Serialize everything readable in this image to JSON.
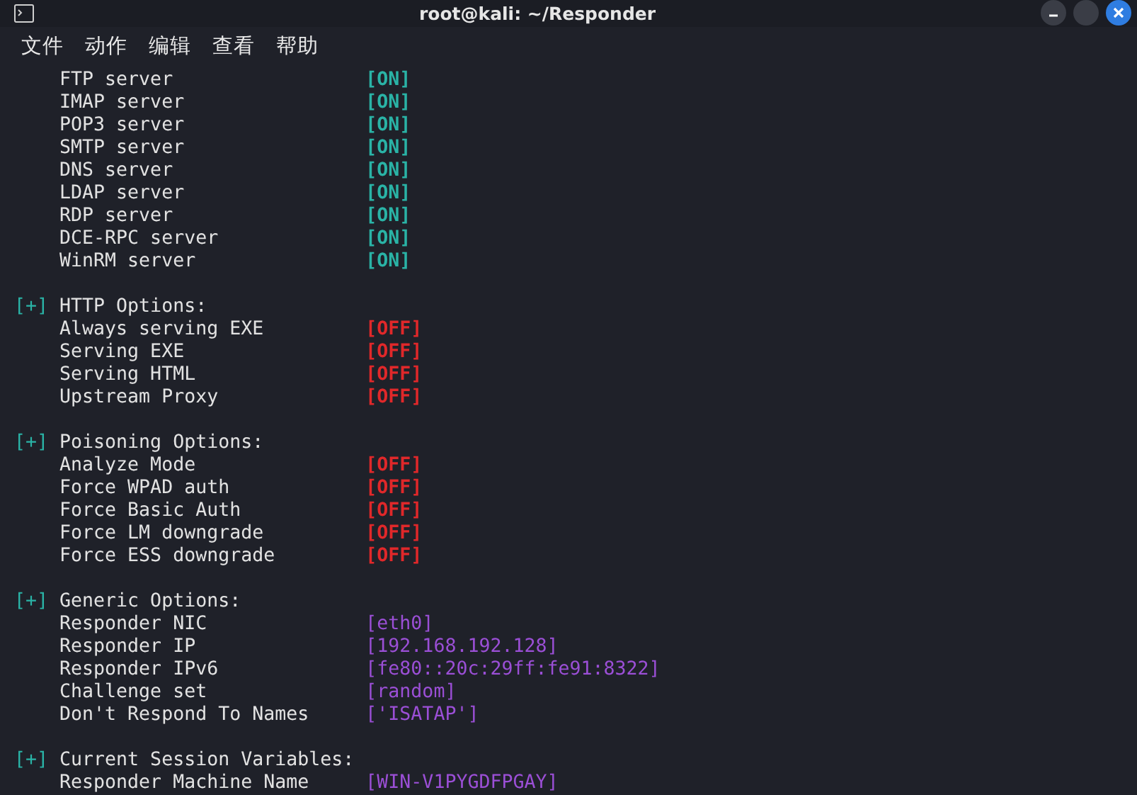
{
  "window": {
    "title": "root@kali: ~/Responder"
  },
  "menu": [
    "文件",
    "动作",
    "编辑",
    "查看",
    "帮助"
  ],
  "sections": [
    {
      "items": [
        {
          "label": "FTP server",
          "value": "[ON]",
          "kind": "on"
        },
        {
          "label": "IMAP server",
          "value": "[ON]",
          "kind": "on"
        },
        {
          "label": "POP3 server",
          "value": "[ON]",
          "kind": "on"
        },
        {
          "label": "SMTP server",
          "value": "[ON]",
          "kind": "on"
        },
        {
          "label": "DNS server",
          "value": "[ON]",
          "kind": "on"
        },
        {
          "label": "LDAP server",
          "value": "[ON]",
          "kind": "on"
        },
        {
          "label": "RDP server",
          "value": "[ON]",
          "kind": "on"
        },
        {
          "label": "DCE-RPC server",
          "value": "[ON]",
          "kind": "on"
        },
        {
          "label": "WinRM server",
          "value": "[ON]",
          "kind": "on"
        }
      ]
    },
    {
      "marker": "[+]",
      "header": "HTTP Options:",
      "items": [
        {
          "label": "Always serving EXE",
          "value": "[OFF]",
          "kind": "off"
        },
        {
          "label": "Serving EXE",
          "value": "[OFF]",
          "kind": "off"
        },
        {
          "label": "Serving HTML",
          "value": "[OFF]",
          "kind": "off"
        },
        {
          "label": "Upstream Proxy",
          "value": "[OFF]",
          "kind": "off"
        }
      ]
    },
    {
      "marker": "[+]",
      "header": "Poisoning Options:",
      "items": [
        {
          "label": "Analyze Mode",
          "value": "[OFF]",
          "kind": "off"
        },
        {
          "label": "Force WPAD auth",
          "value": "[OFF]",
          "kind": "off"
        },
        {
          "label": "Force Basic Auth",
          "value": "[OFF]",
          "kind": "off"
        },
        {
          "label": "Force LM downgrade",
          "value": "[OFF]",
          "kind": "off"
        },
        {
          "label": "Force ESS downgrade",
          "value": "[OFF]",
          "kind": "off"
        }
      ]
    },
    {
      "marker": "[+]",
      "header": "Generic Options:",
      "items": [
        {
          "label": "Responder NIC",
          "value": "[eth0]",
          "kind": "info"
        },
        {
          "label": "Responder IP",
          "value": "[192.168.192.128]",
          "kind": "info"
        },
        {
          "label": "Responder IPv6",
          "value": "[fe80::20c:29ff:fe91:8322]",
          "kind": "info"
        },
        {
          "label": "Challenge set",
          "value": "[random]",
          "kind": "info"
        },
        {
          "label": "Don't Respond To Names",
          "value": "['ISATAP']",
          "kind": "info"
        }
      ]
    },
    {
      "marker": "[+]",
      "header": "Current Session Variables:",
      "items": [
        {
          "label": "Responder Machine Name",
          "value": "[WIN-V1PYGDFPGAY]",
          "kind": "info"
        }
      ]
    }
  ]
}
